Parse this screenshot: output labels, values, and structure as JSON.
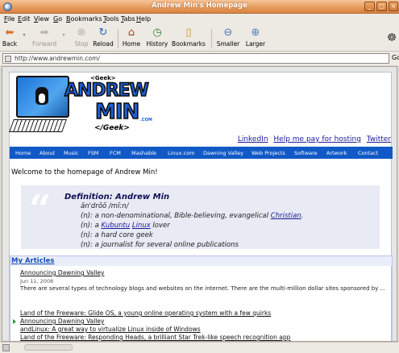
{
  "window": {
    "title": "Andrew Min's Homepage"
  },
  "menu": [
    "File",
    "Edit",
    "View",
    "Go",
    "Bookmarks",
    "Tools",
    "Tabs",
    "Help"
  ],
  "toolbar": {
    "back": "Back",
    "forward": "Forward",
    "stop": "Stop",
    "reload": "Reload",
    "home": "Home",
    "history": "History",
    "bookmarks": "Bookmarks",
    "smaller": "Smaller",
    "larger": "Larger"
  },
  "address": {
    "url": "http://www.andrewmin.com/",
    "go": "Go"
  },
  "logo": {
    "geek_top": "<Geek>",
    "andrew": "ANDREW",
    "min": "MIN",
    "dotcom": ".COM",
    "geek_bottom": "</Geek>"
  },
  "top_links": [
    "LinkedIn",
    "Help me pay for hosting",
    "Twitter"
  ],
  "nav": [
    "Home",
    "About",
    "Music",
    "FSM",
    "FCM",
    "Mashable",
    "Linux.com",
    "Dawning Valley",
    "Web Projects",
    "Software",
    "Artwork",
    "Contact"
  ],
  "welcome": "Welcome to the homepage of Andrew Min!",
  "definition": {
    "title": "Definition: Andrew Min",
    "pronunciation": "ăn'drōō /mĭ:n/",
    "lines": [
      {
        "prefix": "(n): a non-denominational, Bible-believing, evangelical ",
        "link": "Christian",
        "suffix": "."
      },
      {
        "prefix": "(n): a ",
        "link": "Kubuntu",
        "mid": " ",
        "link2": "Linux",
        "suffix": " lover"
      },
      {
        "prefix": "(n): a hard core geek"
      },
      {
        "prefix": "(n): a journalist for several online publications"
      }
    ]
  },
  "articles": {
    "header": "My Articles",
    "featured": {
      "title": "Announcing Dawning Valley",
      "date": "Jun 11, 2008",
      "excerpt": "There are several types of technology blogs and websites on the internet. There are the multi-million dollar sites sponsored by ..."
    },
    "list": [
      "Land of the Freeware: Glide OS, a young online operating system with a few quirks",
      "Announcing Dawning Valley",
      "andLinux: A great way to virtualize Linux inside of Windows",
      "Land of the Freeware: Responding Heads, a brilliant Star Trek-like speech recognition app"
    ]
  }
}
